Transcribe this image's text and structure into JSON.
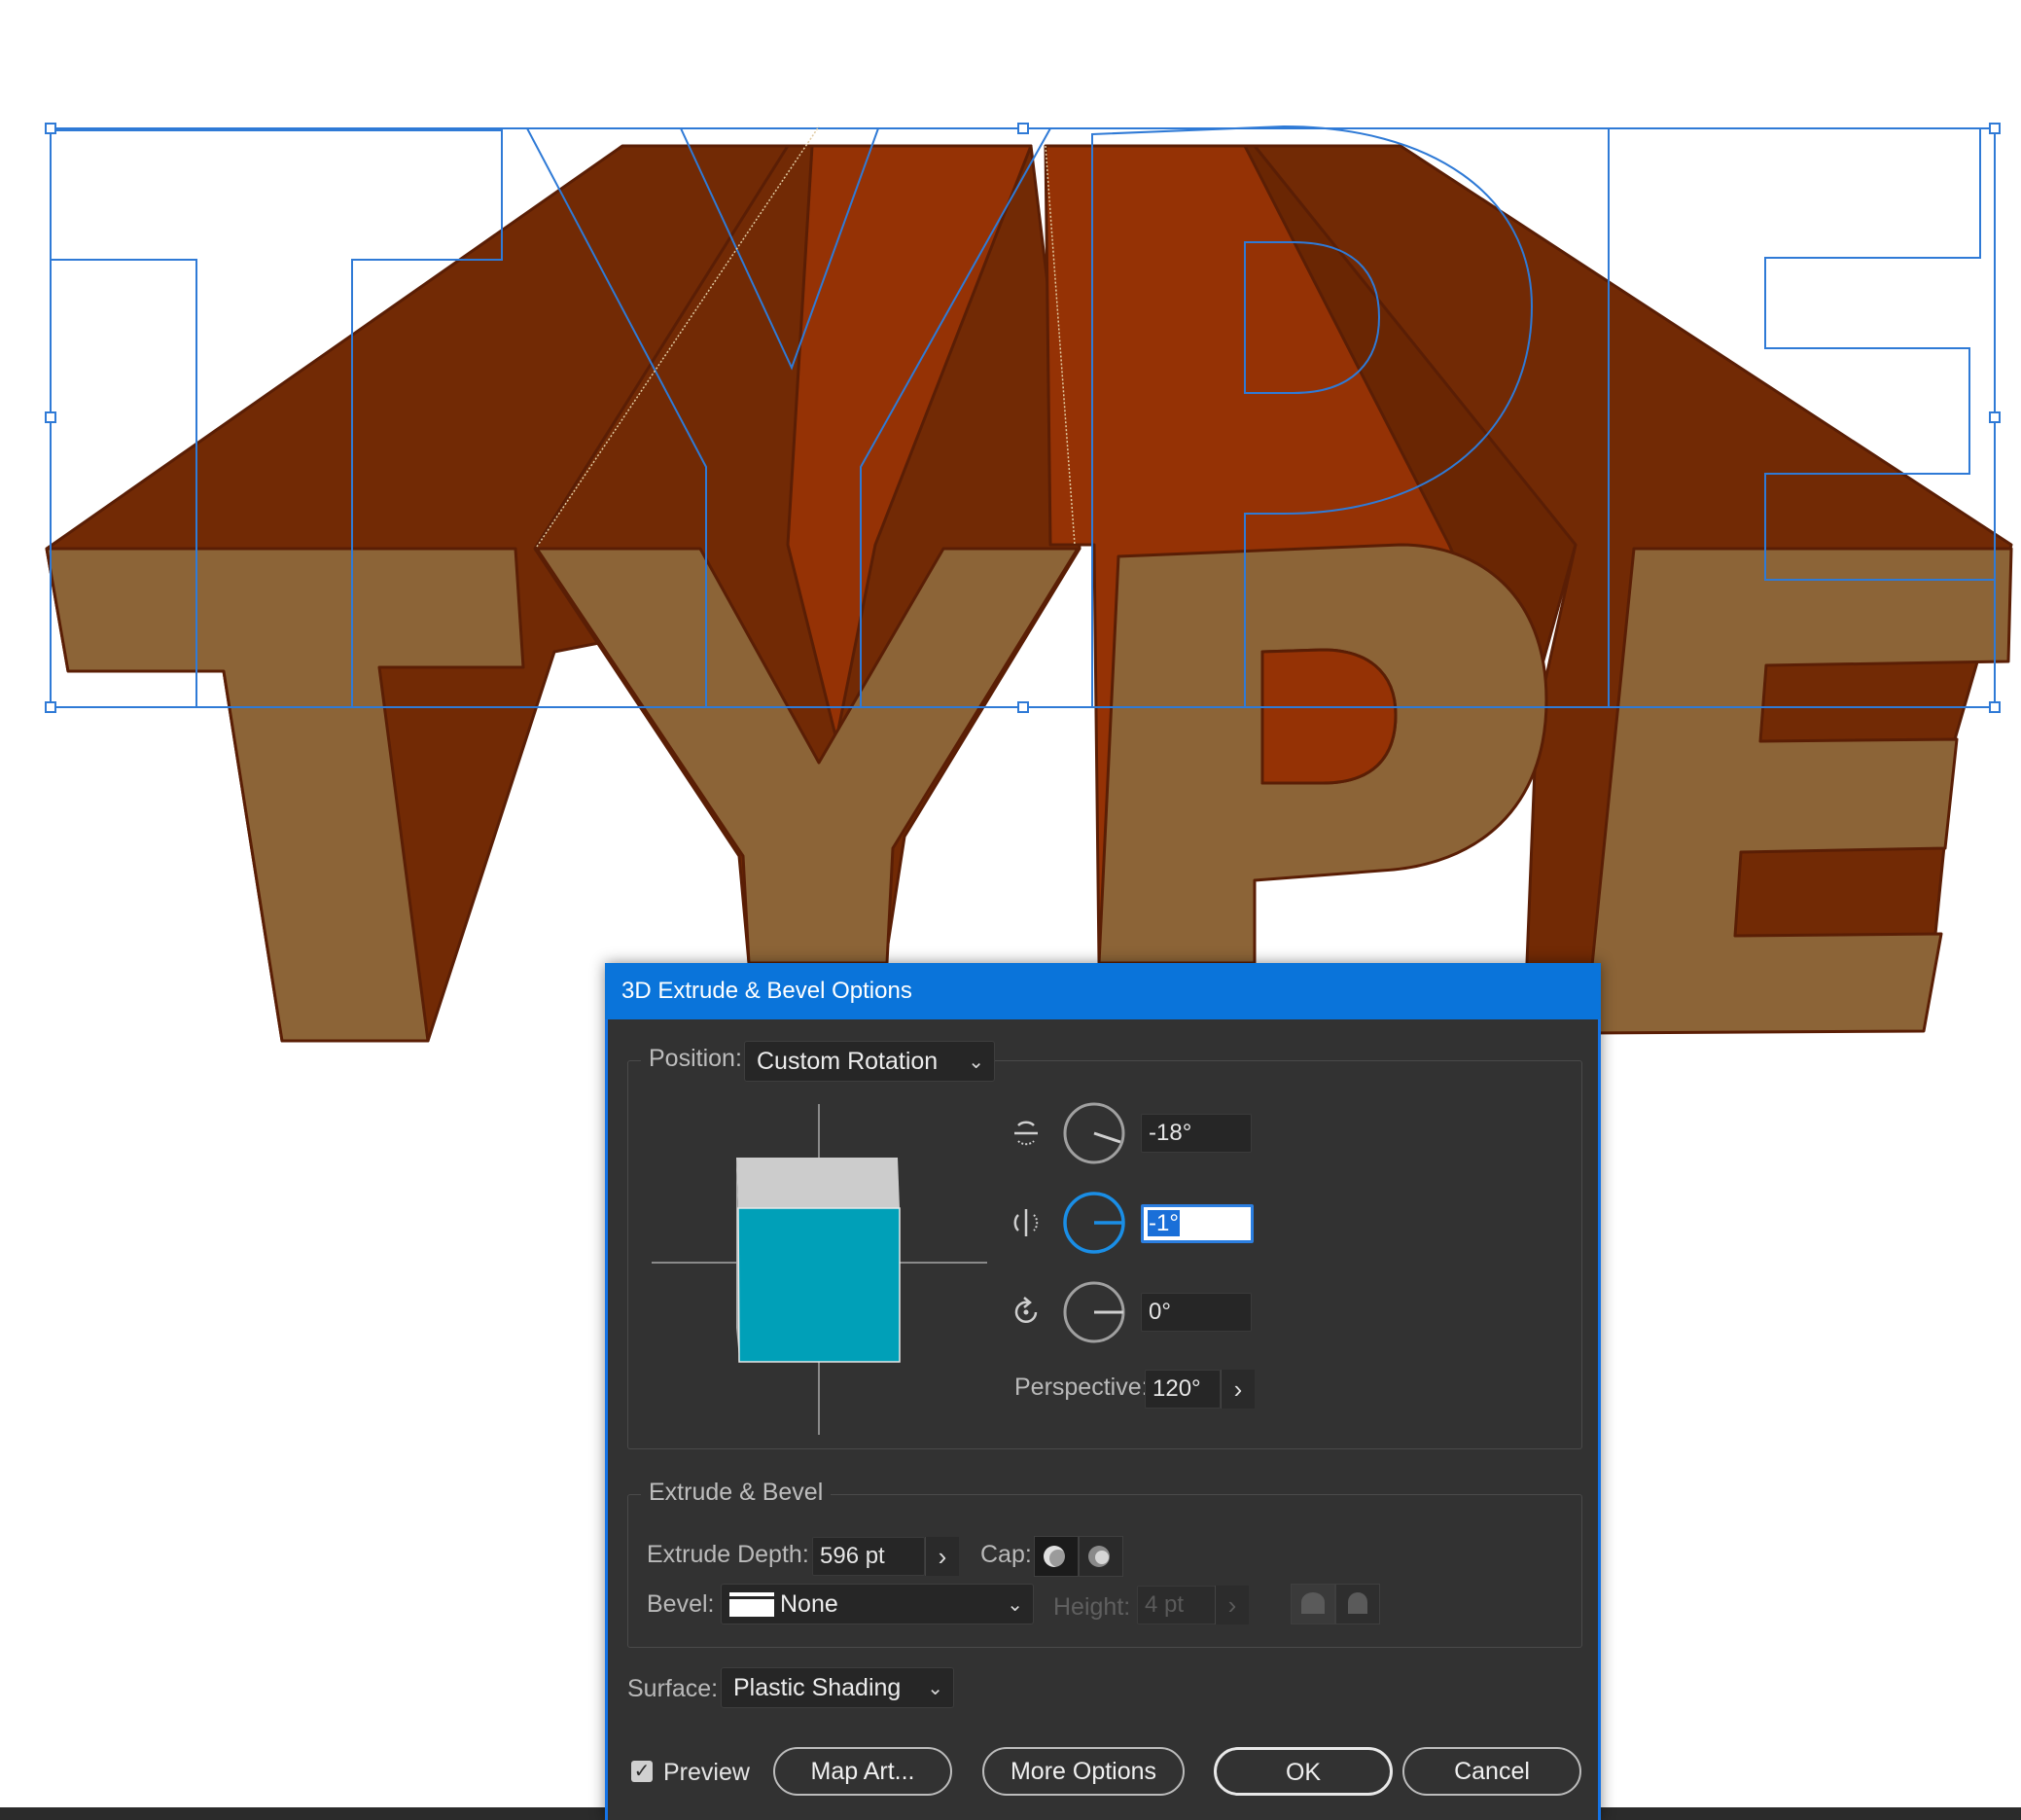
{
  "artwork": {
    "text": "TYPE",
    "colors": {
      "face": "#8c6437",
      "extrusion": "#722a05",
      "extrusion_light": "#953205",
      "outline": "#5a1e05",
      "selection": "#2f7ad6"
    }
  },
  "dialog": {
    "title": "3D Extrude & Bevel Options",
    "position_label": "Position:",
    "position_value": "Custom Rotation",
    "rotation": {
      "x_value": "-18°",
      "y_value": "-1°",
      "z_value": "0°",
      "x_icon": "rotate-x-axis-icon",
      "y_icon": "rotate-y-axis-icon",
      "z_icon": "rotate-z-axis-icon"
    },
    "perspective_label": "Perspective:",
    "perspective_value": "120°",
    "extrude_section_title": "Extrude & Bevel",
    "extrude_depth_label": "Extrude Depth:",
    "extrude_depth_value": "596 pt",
    "cap_label": "Cap:",
    "bevel_label": "Bevel:",
    "bevel_value": "None",
    "height_label": "Height:",
    "height_value": "4 pt",
    "surface_label": "Surface:",
    "surface_value": "Plastic Shading",
    "preview_label": "Preview",
    "preview_checked": true,
    "buttons": {
      "map_art": "Map Art...",
      "more_options": "More Options",
      "ok": "OK",
      "cancel": "Cancel"
    },
    "colors": {
      "titlebar": "#0a74da",
      "cube_front": "#00a0b8",
      "cube_top": "#cccccc",
      "active_dial": "#1a8ee6"
    }
  }
}
